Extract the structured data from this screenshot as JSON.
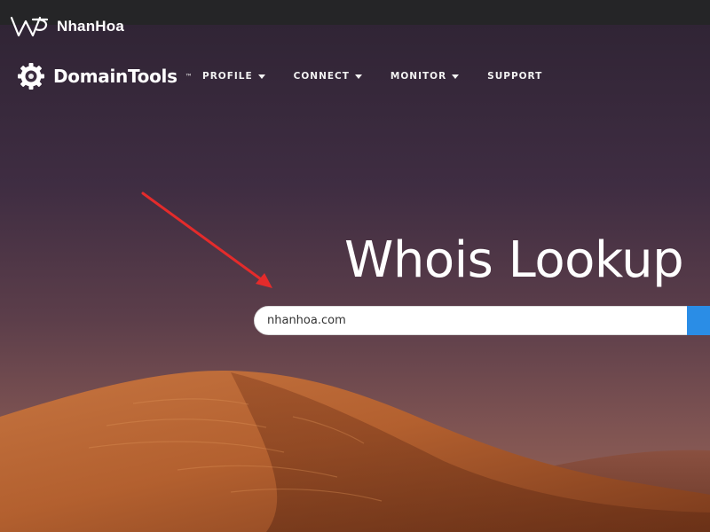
{
  "watermark": {
    "brand": "NhanHoa"
  },
  "header": {
    "brand_name": "DomainTools",
    "brand_tm": "™",
    "nav": [
      {
        "label": "PROFILE",
        "has_dropdown": true
      },
      {
        "label": "CONNECT",
        "has_dropdown": true
      },
      {
        "label": "MONITOR",
        "has_dropdown": true
      },
      {
        "label": "SUPPORT",
        "has_dropdown": false
      }
    ]
  },
  "hero": {
    "title": "Whois Lookup",
    "search": {
      "value": "nhanhoa.com",
      "placeholder": ""
    }
  },
  "colors": {
    "search_button": "#2a8de6",
    "annotation_arrow": "#e42b2b",
    "watermark_bar": "#252527"
  },
  "icons": {
    "logo": "gear-icon",
    "watermark": "nhanhoa-logo-icon",
    "dropdown": "caret-down-icon",
    "annotation": "arrow-icon"
  }
}
